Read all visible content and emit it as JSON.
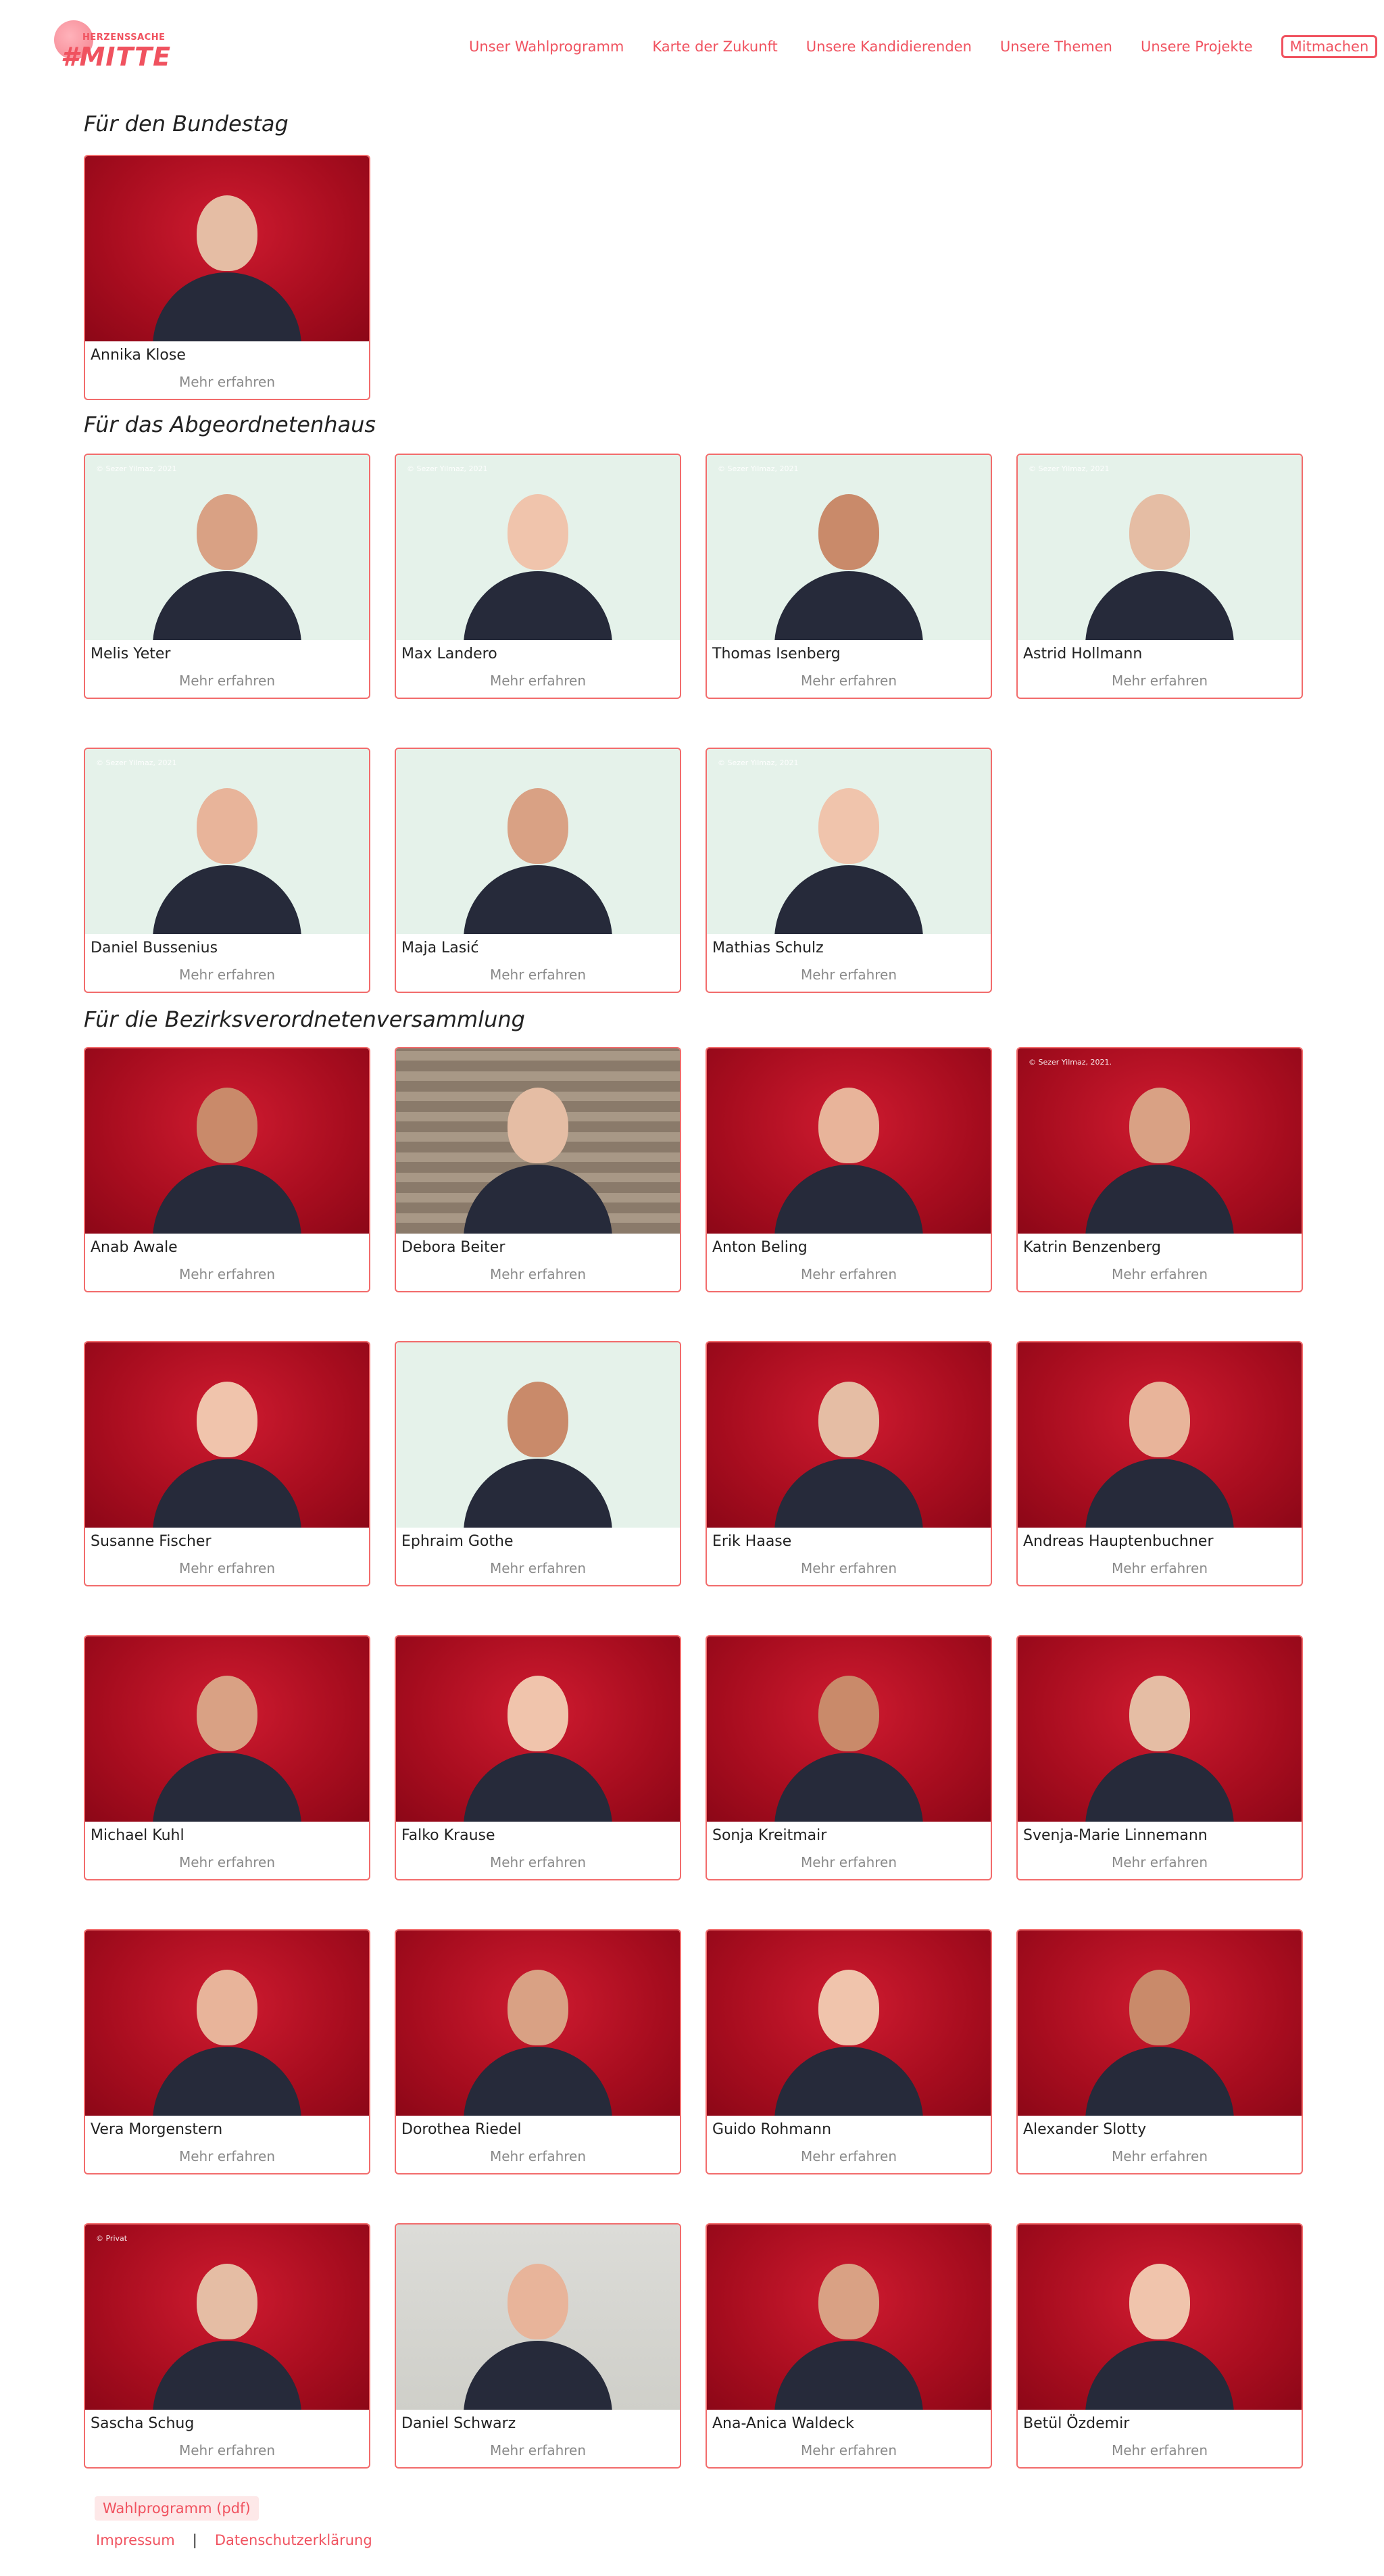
{
  "brand": {
    "logo_top": "HERZENSSACHE",
    "logo_main": "#MITTE"
  },
  "nav": {
    "items": [
      "Unser Wahlprogramm",
      "Karte der Zukunft",
      "Unsere Kandidierenden",
      "Unsere Themen",
      "Unsere Projekte"
    ],
    "cta": "Mitmachen"
  },
  "sections": {
    "bundestag": {
      "title": "Für den Bundestag"
    },
    "abgeordnetenhaus": {
      "title": "Für das Abgeordnetenhaus"
    },
    "bvv": {
      "title": "Für die Bezirksverordnetenversammlung"
    }
  },
  "card": {
    "more_label": "Mehr erfahren"
  },
  "candidates": {
    "bundestag": [
      {
        "name": "Annika Klose",
        "bg": "red"
      }
    ],
    "abgeordnetenhaus": [
      {
        "name": "Melis Yeter",
        "bg": "mint",
        "copyright": "© Sezer Yilmaz, 2021"
      },
      {
        "name": "Max Landero",
        "bg": "mint",
        "copyright": "© Sezer Yilmaz, 2021"
      },
      {
        "name": "Thomas Isenberg",
        "bg": "mint",
        "copyright": "© Sezer Yilmaz, 2021"
      },
      {
        "name": "Astrid Hollmann",
        "bg": "mint",
        "copyright": "© Sezer Yilmaz, 2021"
      },
      {
        "name": "Daniel Bussenius",
        "bg": "mint",
        "copyright": "© Sezer Yilmaz, 2021"
      },
      {
        "name": "Maja Lasić",
        "bg": "mint"
      },
      {
        "name": "Mathias Schulz",
        "bg": "mint",
        "copyright": "© Sezer Yilmaz, 2021"
      }
    ],
    "bvv": [
      {
        "name": "Anab Awale",
        "bg": "red"
      },
      {
        "name": "Debora Beiter",
        "bg": "brick"
      },
      {
        "name": "Anton Beling",
        "bg": "red"
      },
      {
        "name": "Katrin Benzenberg",
        "bg": "red",
        "copyright": "© Sezer Yilmaz, 2021."
      },
      {
        "name": "Susanne Fischer",
        "bg": "red"
      },
      {
        "name": "Ephraim Gothe",
        "bg": "mint"
      },
      {
        "name": "Erik Haase",
        "bg": "red"
      },
      {
        "name": "Andreas Hauptenbuchner",
        "bg": "red"
      },
      {
        "name": "Michael Kuhl",
        "bg": "red"
      },
      {
        "name": "Falko Krause",
        "bg": "red"
      },
      {
        "name": "Sonja Kreitmair",
        "bg": "red"
      },
      {
        "name": "Svenja-Marie Linnemann",
        "bg": "red"
      },
      {
        "name": "Vera Morgenstern",
        "bg": "red"
      },
      {
        "name": "Dorothea Riedel",
        "bg": "red"
      },
      {
        "name": "Guido Rohmann",
        "bg": "red"
      },
      {
        "name": "Alexander Slotty",
        "bg": "red"
      },
      {
        "name": "Sascha Schug",
        "bg": "red",
        "copyright": "© Privat"
      },
      {
        "name": "Daniel Schwarz",
        "bg": "grey"
      },
      {
        "name": "Ana-Anica Waldeck",
        "bg": "red"
      },
      {
        "name": "Betül Özdemir",
        "bg": "red"
      }
    ]
  },
  "footer": {
    "program_pdf": "Wahlprogramm (pdf)",
    "imprint": "Impressum",
    "separator": "|",
    "privacy": "Datenschutzerklärung"
  },
  "colors": {
    "accent": "#f0525f",
    "card_border": "#f26c6c",
    "photo_red": "#a80d1f",
    "photo_mint": "#e5f2ea"
  }
}
